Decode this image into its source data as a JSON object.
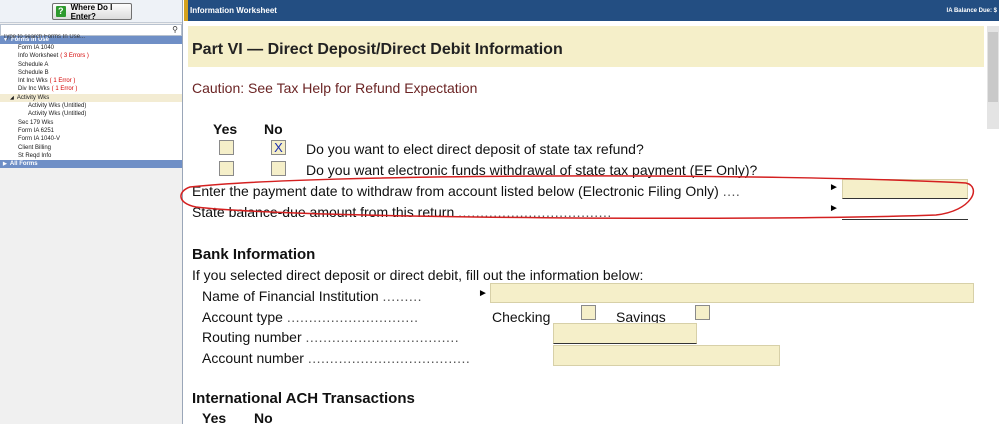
{
  "sidebar": {
    "where_button": "Where Do I Enter?",
    "search_placeholder": "Type to search Forms In Use...",
    "group_forms_in_use": "Forms In Use",
    "group_all_forms": "All Forms",
    "items": [
      {
        "label": "Form IA 1040",
        "err": ""
      },
      {
        "label": "Info Worksheet",
        "err": "( 3 Errors )"
      },
      {
        "label": "Schedule A",
        "err": ""
      },
      {
        "label": "Schedule B",
        "err": ""
      },
      {
        "label": "Int Inc Wks",
        "err": "( 1 Error )"
      },
      {
        "label": "Div Inc Wks",
        "err": "( 1 Error )"
      },
      {
        "label": "Activity Wks",
        "err": ""
      },
      {
        "label": "Activity Wks (Untitled)",
        "err": ""
      },
      {
        "label": "Activity Wks (Untitled)",
        "err": ""
      },
      {
        "label": "Sec 179 Wks",
        "err": ""
      },
      {
        "label": "Form IA 6251",
        "err": ""
      },
      {
        "label": "Form IA 1040-V",
        "err": ""
      },
      {
        "label": "Client Billing",
        "err": ""
      },
      {
        "label": "St Reqd Info",
        "err": ""
      }
    ]
  },
  "main": {
    "window_title": "Information Worksheet",
    "balance_due": "IA Balance Due: $",
    "part_title": "Part VI — Direct Deposit/Direct Debit Information",
    "caution": "Caution: See Tax Help for Refund Expectation",
    "yes": "Yes",
    "no": "No",
    "x_mark": "X",
    "q1": "Do you want to elect direct deposit of state tax refund?",
    "q2": "Do you want electronic funds withdrawal of state tax payment (EF Only)?",
    "payment_date_label": "Enter the payment date to withdraw from account listed below (Electronic Filing Only)",
    "balance_label": "State balance-due amount from this return",
    "bank_heading": "Bank Information",
    "bank_intro": "If you selected direct deposit or direct debit, fill out the information below:",
    "fin_inst_label": "Name of Financial Institution",
    "acct_type_label": "Account type",
    "checking": "Checking",
    "savings": "Savings",
    "routing_label": "Routing number",
    "account_label": "Account number",
    "intl_heading": "International ACH Transactions",
    "intl_yes": "Yes",
    "intl_no": "No"
  },
  "colors": {
    "title_bar": "#234e82",
    "field_fill": "#f5efc9",
    "annotation": "#d42020",
    "error_text": "#d40000"
  }
}
